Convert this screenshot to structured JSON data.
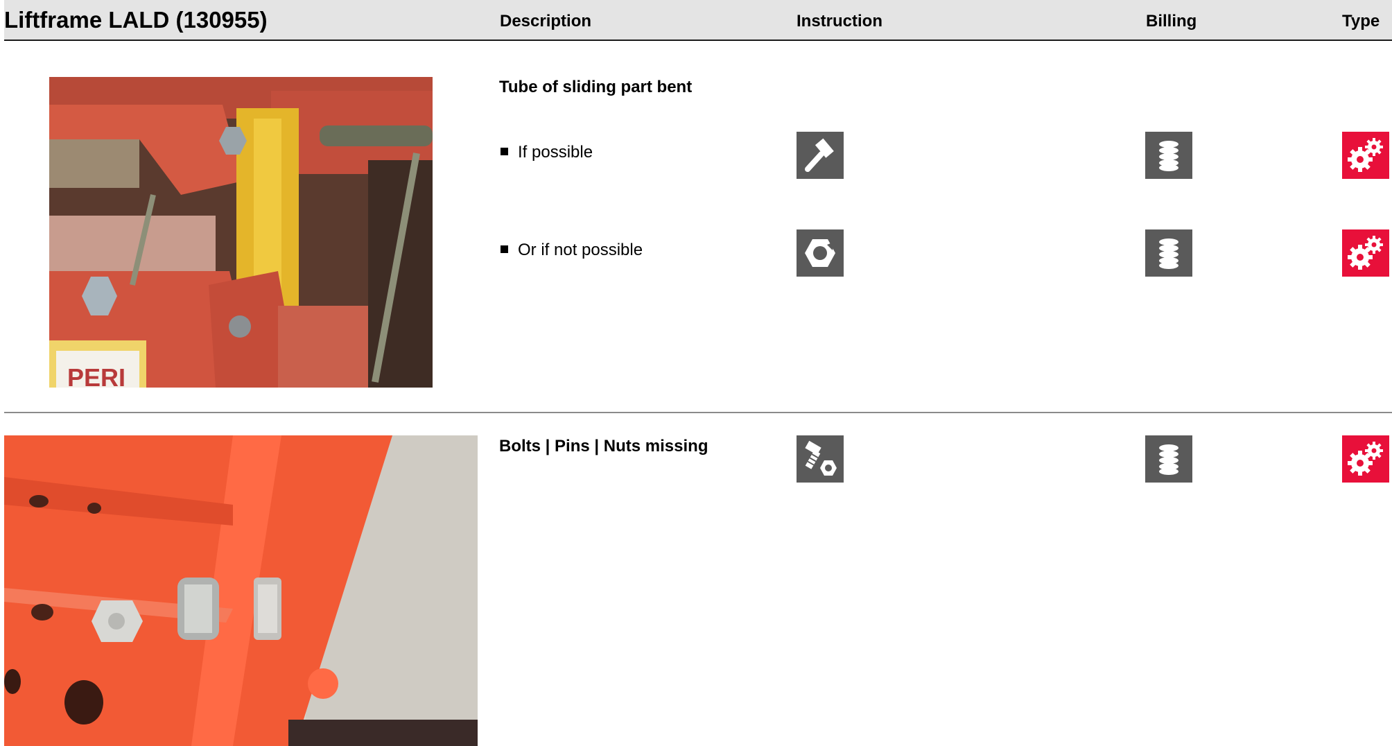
{
  "header": {
    "title": "Liftframe LALD (130955)",
    "col_description": "Description",
    "col_instruction": "Instruction",
    "col_billing": "Billing",
    "col_type": "Type"
  },
  "damages": [
    {
      "title": "Tube of sliding part bent",
      "photo": "photo of a red and yellow lift frame with a bent sliding tube",
      "photo_label": "PERI",
      "options": [
        {
          "label": "If possible",
          "instruction_icon": "hammer-icon",
          "billing_icon": "coins-stack-icon",
          "type_icon": "gears-icon"
        },
        {
          "label": "Or if not possible",
          "instruction_icon": "replace-part-icon",
          "billing_icon": "coins-stack-icon",
          "type_icon": "gears-icon"
        }
      ]
    },
    {
      "title": "Bolts | Pins | Nuts missing",
      "photo": "photo of red steel frame with bolts and nuts",
      "instruction_icon": "bolt-nut-icon",
      "billing_icon": "coins-stack-icon",
      "type_icon": "gears-icon"
    }
  ],
  "colors": {
    "header_bg": "#e4e4e4",
    "icon_gray": "#5a5a5a",
    "type_red": "#e8103a"
  }
}
